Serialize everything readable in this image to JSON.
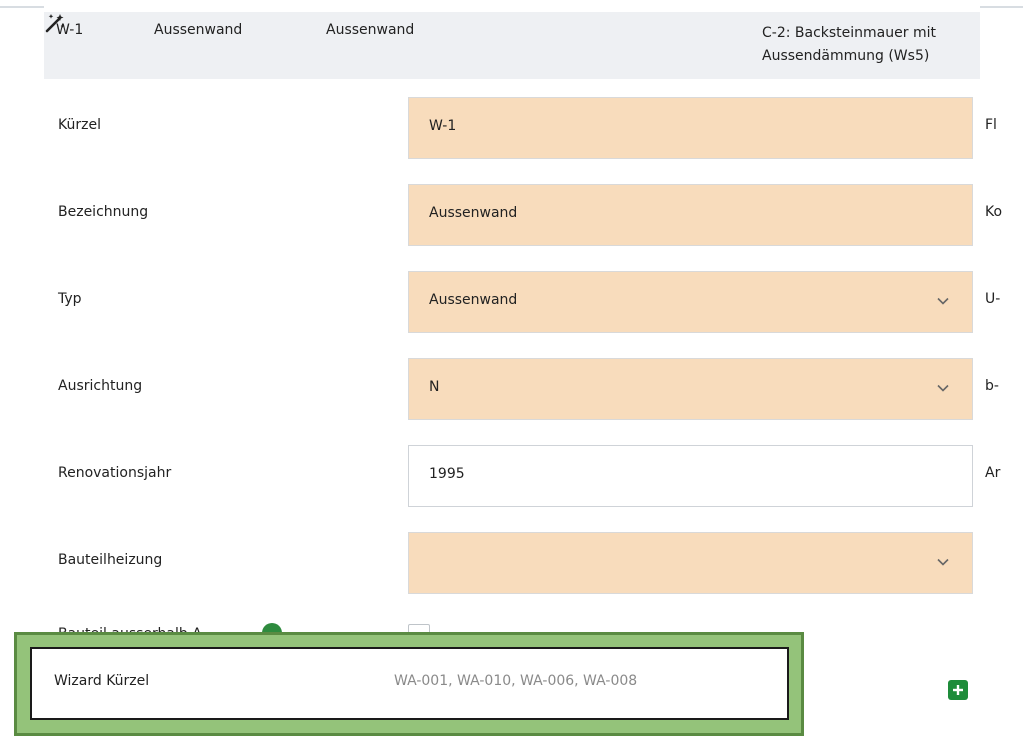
{
  "header": {
    "code": "W-1",
    "type": "Aussenwand",
    "description": "Aussenwand",
    "construction": "C-2: Backsteinmauer mit Aussendämmung (Ws5)",
    "wand_icon": "magic-wand-icon"
  },
  "fields": [
    {
      "label": "Kürzel",
      "value": "W-1",
      "right_label": "Fl"
    },
    {
      "label": "Bezeichnung",
      "value": "Aussenwand",
      "right_label": "Ko"
    },
    {
      "label": "Typ",
      "value": "Aussenwand",
      "right_label": "U-"
    },
    {
      "label": "Ausrichtung",
      "value": "N",
      "right_label": "b-"
    },
    {
      "label": "Renovationsjahr",
      "value": "1995",
      "right_label": "Ar"
    },
    {
      "label": "Bauteilheizung",
      "value": ""
    }
  ],
  "hidden_row": {
    "label": "Bauteil ausserhalb A",
    "info_icon": "info-icon"
  },
  "wizard": {
    "label": "Wizard Kürzel",
    "value": "WA-001, WA-010, WA-006, WA-008",
    "add_icon": "plus-icon"
  },
  "colors": {
    "field_fill": "#f8dcbc",
    "header_bg": "#eef0f3",
    "highlight_green": "#94c37a",
    "highlight_border": "#5a8b42",
    "accent_green": "#1e8c3a"
  }
}
